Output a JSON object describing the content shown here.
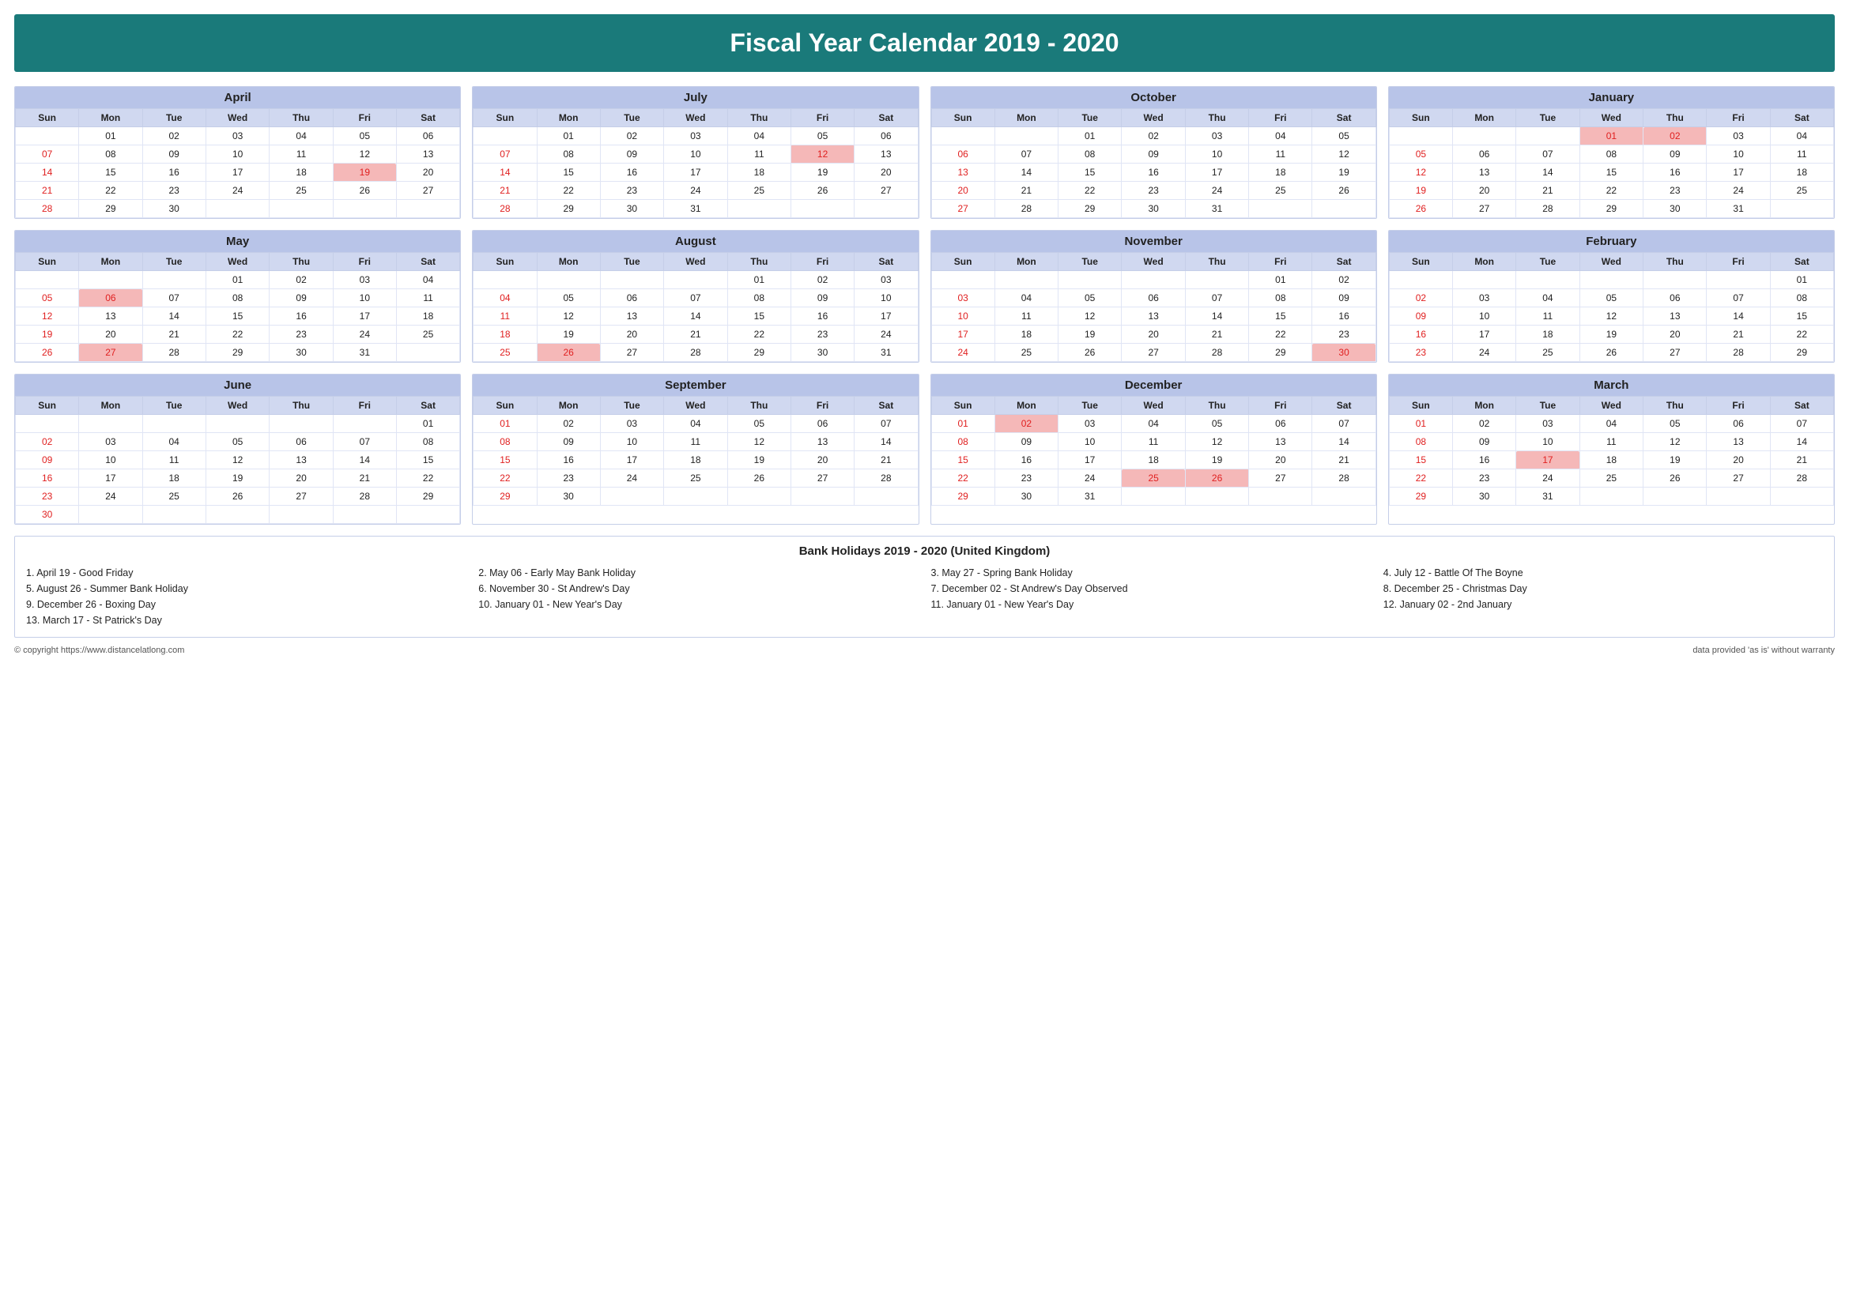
{
  "title": "Fiscal Year Calendar 2019 - 2020",
  "months": [
    {
      "name": "April",
      "days_header": [
        "Sun",
        "Mon",
        "Tue",
        "Wed",
        "Thu",
        "Fri",
        "Sat"
      ],
      "weeks": [
        [
          "",
          "01",
          "02",
          "03",
          "04",
          "05",
          "06"
        ],
        [
          "07",
          "08",
          "09",
          "10",
          "11",
          "12",
          "13"
        ],
        [
          "14",
          "15",
          "16",
          "17",
          "18",
          "19",
          "20"
        ],
        [
          "21",
          "22",
          "23",
          "24",
          "25",
          "26",
          "27"
        ],
        [
          "28",
          "29",
          "30",
          "",
          "",
          "",
          ""
        ]
      ],
      "sundays": [
        "07",
        "14",
        "21",
        "28"
      ],
      "holidays": [
        "19"
      ]
    },
    {
      "name": "July",
      "days_header": [
        "Sun",
        "Mon",
        "Tue",
        "Wed",
        "Thu",
        "Fri",
        "Sat"
      ],
      "weeks": [
        [
          "",
          "01",
          "02",
          "03",
          "04",
          "05",
          "06"
        ],
        [
          "07",
          "08",
          "09",
          "10",
          "11",
          "12",
          "13"
        ],
        [
          "14",
          "15",
          "16",
          "17",
          "18",
          "19",
          "20"
        ],
        [
          "21",
          "22",
          "23",
          "24",
          "25",
          "26",
          "27"
        ],
        [
          "28",
          "29",
          "30",
          "31",
          "",
          "",
          ""
        ]
      ],
      "sundays": [
        "07",
        "14",
        "21",
        "28"
      ],
      "holidays": [
        "12"
      ]
    },
    {
      "name": "October",
      "days_header": [
        "Sun",
        "Mon",
        "Tue",
        "Wed",
        "Thu",
        "Fri",
        "Sat"
      ],
      "weeks": [
        [
          "",
          "",
          "01",
          "02",
          "03",
          "04",
          "05"
        ],
        [
          "06",
          "07",
          "08",
          "09",
          "10",
          "11",
          "12"
        ],
        [
          "13",
          "14",
          "15",
          "16",
          "17",
          "18",
          "19"
        ],
        [
          "20",
          "21",
          "22",
          "23",
          "24",
          "25",
          "26"
        ],
        [
          "27",
          "28",
          "29",
          "30",
          "31",
          "",
          ""
        ]
      ],
      "sundays": [
        "06",
        "13",
        "20",
        "27"
      ],
      "holidays": []
    },
    {
      "name": "January",
      "days_header": [
        "Sun",
        "Mon",
        "Tue",
        "Wed",
        "Thu",
        "Fri",
        "Sat"
      ],
      "weeks": [
        [
          "",
          "",
          "",
          "01",
          "02",
          "03",
          "04"
        ],
        [
          "05",
          "06",
          "07",
          "08",
          "09",
          "10",
          "11"
        ],
        [
          "12",
          "13",
          "14",
          "15",
          "16",
          "17",
          "18"
        ],
        [
          "19",
          "20",
          "21",
          "22",
          "23",
          "24",
          "25"
        ],
        [
          "26",
          "27",
          "28",
          "29",
          "30",
          "31",
          ""
        ]
      ],
      "sundays": [
        "05",
        "12",
        "19",
        "26"
      ],
      "holidays": [
        "01",
        "02"
      ]
    },
    {
      "name": "May",
      "days_header": [
        "Sun",
        "Mon",
        "Tue",
        "Wed",
        "Thu",
        "Fri",
        "Sat"
      ],
      "weeks": [
        [
          "",
          "",
          "",
          "01",
          "02",
          "03",
          "04"
        ],
        [
          "05",
          "06",
          "07",
          "08",
          "09",
          "10",
          "11"
        ],
        [
          "12",
          "13",
          "14",
          "15",
          "16",
          "17",
          "18"
        ],
        [
          "19",
          "20",
          "21",
          "22",
          "23",
          "24",
          "25"
        ],
        [
          "26",
          "27",
          "28",
          "29",
          "30",
          "31",
          ""
        ]
      ],
      "sundays": [
        "05",
        "12",
        "19",
        "26"
      ],
      "holidays": [
        "06",
        "27"
      ]
    },
    {
      "name": "August",
      "days_header": [
        "Sun",
        "Mon",
        "Tue",
        "Wed",
        "Thu",
        "Fri",
        "Sat"
      ],
      "weeks": [
        [
          "",
          "",
          "",
          "",
          "01",
          "02",
          "03"
        ],
        [
          "04",
          "05",
          "06",
          "07",
          "08",
          "09",
          "10"
        ],
        [
          "11",
          "12",
          "13",
          "14",
          "15",
          "16",
          "17"
        ],
        [
          "18",
          "19",
          "20",
          "21",
          "22",
          "23",
          "24"
        ],
        [
          "25",
          "26",
          "27",
          "28",
          "29",
          "30",
          "31"
        ]
      ],
      "sundays": [
        "04",
        "11",
        "18",
        "25"
      ],
      "holidays": [
        "26"
      ]
    },
    {
      "name": "November",
      "days_header": [
        "Sun",
        "Mon",
        "Tue",
        "Wed",
        "Thu",
        "Fri",
        "Sat"
      ],
      "weeks": [
        [
          "",
          "",
          "",
          "",
          "",
          "01",
          "02"
        ],
        [
          "03",
          "04",
          "05",
          "06",
          "07",
          "08",
          "09"
        ],
        [
          "10",
          "11",
          "12",
          "13",
          "14",
          "15",
          "16"
        ],
        [
          "17",
          "18",
          "19",
          "20",
          "21",
          "22",
          "23"
        ],
        [
          "24",
          "25",
          "26",
          "27",
          "28",
          "29",
          "30"
        ]
      ],
      "sundays": [
        "03",
        "10",
        "17",
        "24"
      ],
      "holidays": [
        "30"
      ]
    },
    {
      "name": "February",
      "days_header": [
        "Sun",
        "Mon",
        "Tue",
        "Wed",
        "Thu",
        "Fri",
        "Sat"
      ],
      "weeks": [
        [
          "",
          "",
          "",
          "",
          "",
          "",
          "01"
        ],
        [
          "02",
          "03",
          "04",
          "05",
          "06",
          "07",
          "08"
        ],
        [
          "09",
          "10",
          "11",
          "12",
          "13",
          "14",
          "15"
        ],
        [
          "16",
          "17",
          "18",
          "19",
          "20",
          "21",
          "22"
        ],
        [
          "23",
          "24",
          "25",
          "26",
          "27",
          "28",
          "29"
        ]
      ],
      "sundays": [
        "02",
        "09",
        "16",
        "23"
      ],
      "holidays": []
    },
    {
      "name": "June",
      "days_header": [
        "Sun",
        "Mon",
        "Tue",
        "Wed",
        "Thu",
        "Fri",
        "Sat"
      ],
      "weeks": [
        [
          "",
          "",
          "",
          "",
          "",
          "",
          "01"
        ],
        [
          "02",
          "03",
          "04",
          "05",
          "06",
          "07",
          "08"
        ],
        [
          "09",
          "10",
          "11",
          "12",
          "13",
          "14",
          "15"
        ],
        [
          "16",
          "17",
          "18",
          "19",
          "20",
          "21",
          "22"
        ],
        [
          "23",
          "24",
          "25",
          "26",
          "27",
          "28",
          "29"
        ],
        [
          "30",
          "",
          "",
          "",
          "",
          "",
          ""
        ]
      ],
      "sundays": [
        "02",
        "09",
        "16",
        "23",
        "30"
      ],
      "holidays": []
    },
    {
      "name": "September",
      "days_header": [
        "Sun",
        "Mon",
        "Tue",
        "Wed",
        "Thu",
        "Fri",
        "Sat"
      ],
      "weeks": [
        [
          "01",
          "02",
          "03",
          "04",
          "05",
          "06",
          "07"
        ],
        [
          "08",
          "09",
          "10",
          "11",
          "12",
          "13",
          "14"
        ],
        [
          "15",
          "16",
          "17",
          "18",
          "19",
          "20",
          "21"
        ],
        [
          "22",
          "23",
          "24",
          "25",
          "26",
          "27",
          "28"
        ],
        [
          "29",
          "30",
          "",
          "",
          "",
          "",
          ""
        ]
      ],
      "sundays": [
        "01",
        "08",
        "15",
        "22",
        "29"
      ],
      "holidays": []
    },
    {
      "name": "December",
      "days_header": [
        "Sun",
        "Mon",
        "Tue",
        "Wed",
        "Thu",
        "Fri",
        "Sat"
      ],
      "weeks": [
        [
          "01",
          "02",
          "03",
          "04",
          "05",
          "06",
          "07"
        ],
        [
          "08",
          "09",
          "10",
          "11",
          "12",
          "13",
          "14"
        ],
        [
          "15",
          "16",
          "17",
          "18",
          "19",
          "20",
          "21"
        ],
        [
          "22",
          "23",
          "24",
          "25",
          "26",
          "27",
          "28"
        ],
        [
          "29",
          "30",
          "31",
          "",
          "",
          "",
          ""
        ]
      ],
      "sundays": [
        "01",
        "08",
        "15",
        "22",
        "29"
      ],
      "holidays": [
        "02",
        "25",
        "26"
      ]
    },
    {
      "name": "March",
      "days_header": [
        "Sun",
        "Mon",
        "Tue",
        "Wed",
        "Thu",
        "Fri",
        "Sat"
      ],
      "weeks": [
        [
          "01",
          "02",
          "03",
          "04",
          "05",
          "06",
          "07"
        ],
        [
          "08",
          "09",
          "10",
          "11",
          "12",
          "13",
          "14"
        ],
        [
          "15",
          "16",
          "17",
          "18",
          "19",
          "20",
          "21"
        ],
        [
          "22",
          "23",
          "24",
          "25",
          "26",
          "27",
          "28"
        ],
        [
          "29",
          "30",
          "31",
          "",
          "",
          "",
          ""
        ]
      ],
      "sundays": [
        "01",
        "08",
        "15",
        "22",
        "29"
      ],
      "holidays": [
        "17"
      ]
    }
  ],
  "bank_holidays_title": "Bank Holidays 2019 - 2020 (United Kingdom)",
  "bank_holidays": [
    "1. April 19 - Good Friday",
    "2. May 06 - Early May Bank Holiday",
    "3. May 27 - Spring Bank Holiday",
    "4. July 12 - Battle Of The Boyne",
    "5. August 26 - Summer Bank Holiday",
    "6. November 30 - St Andrew's Day",
    "7. December 02 - St Andrew's Day Observed",
    "8. December 25 - Christmas Day",
    "9. December 26 - Boxing Day",
    "10. January 01 - New Year's Day",
    "11. January 01 - New Year's Day",
    "12. January 02 - 2nd January",
    "13. March 17 - St Patrick's Day",
    "",
    "",
    ""
  ],
  "footer_left": "© copyright https://www.distancelatlong.com",
  "footer_right": "data provided 'as is' without warranty"
}
